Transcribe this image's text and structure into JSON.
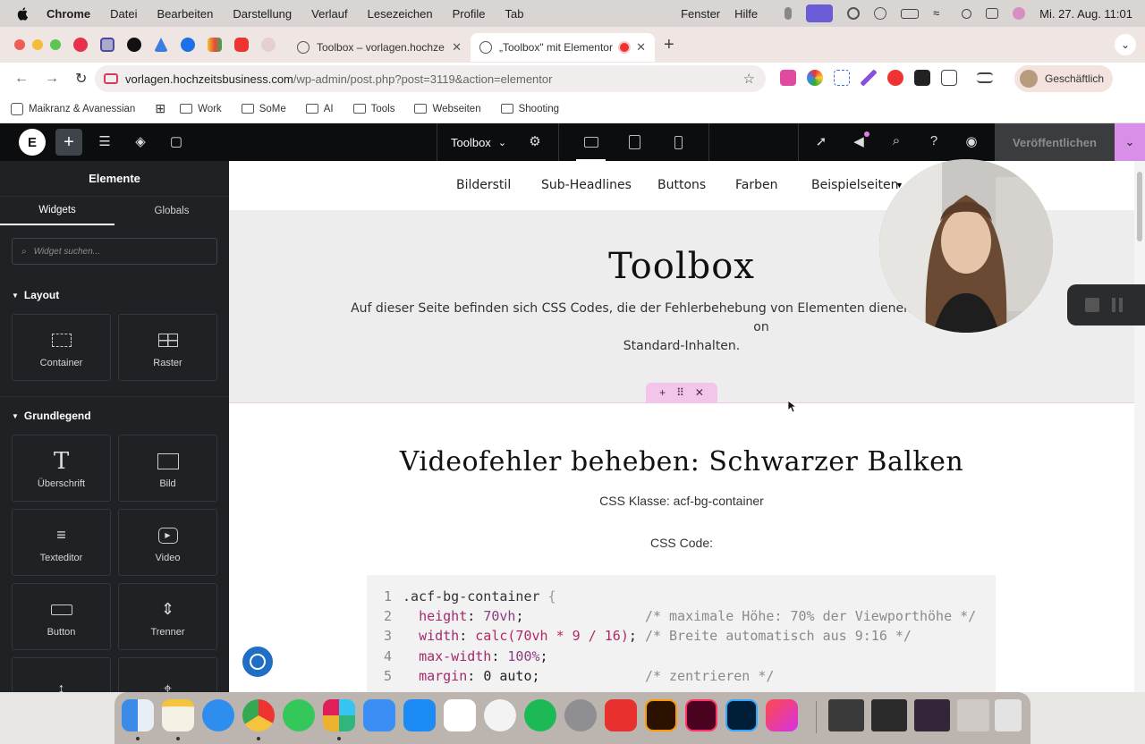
{
  "menubar": {
    "app": "Chrome",
    "items": [
      "Datei",
      "Bearbeiten",
      "Darstellung",
      "Verlauf",
      "Lesezeichen",
      "Profile",
      "Tab",
      "Fenster",
      "Hilfe"
    ],
    "clock": "Mi. 27. Aug.  11:01"
  },
  "tabs": [
    {
      "title": "Toolbox – vorlagen.hochzeits"
    },
    {
      "title": "„Toolbox\" mit Elementor b"
    }
  ],
  "address": {
    "host": "vorlagen.hochzeitsbusiness.com",
    "path": "/wp-admin/post.php?post=3119&action=elementor"
  },
  "profile": {
    "label": "Geschäftlich"
  },
  "bookmarks": [
    "Maikranz & Avanessian",
    "Work",
    "SoMe",
    "AI",
    "Tools",
    "Webseiten",
    "Shooting"
  ],
  "elementor": {
    "document": "Toolbox",
    "publish": "Veröffentlichen",
    "panel": {
      "title": "Elemente",
      "tabs": [
        "Widgets",
        "Globals"
      ],
      "search_placeholder": "Widget suchen...",
      "sections": [
        {
          "label": "Layout",
          "widgets": [
            "Container",
            "Raster"
          ]
        },
        {
          "label": "Grundlegend",
          "widgets": [
            "Überschrift",
            "Bild",
            "Texteditor",
            "Video",
            "Button",
            "Trenner"
          ]
        }
      ]
    }
  },
  "site": {
    "nav": [
      "Bilderstil",
      "Sub-Headlines",
      "Buttons",
      "Farben",
      "Beispielseiten"
    ],
    "hero_title": "Toolbox",
    "hero_text": "Auf dieser Seite befinden sich CSS Codes, die der Fehlerbehebung von Elementen dienen. Primär aber au",
    "hero_text_tail": "on",
    "hero_text_line2": "Standard-Inhalten.",
    "section_title": "Videofehler beheben: Schwarzer Balken",
    "css_class": "CSS Klasse: acf-bg-container",
    "css_code_label": "CSS Code:",
    "code_lines": [
      {
        "n": "1",
        "sel": ".acf-bg-container",
        "rest": " {"
      },
      {
        "n": "2",
        "prop": "height",
        "val": "70vh",
        "pad": "               ",
        "comment": "/* maximale Höhe: 70% der Viewporthöhe */"
      },
      {
        "n": "3",
        "prop": "width",
        "val": "calc(70vh * 9 / 16)",
        "pad": " ",
        "comment": "/* Breite automatisch aus 9:16 */"
      },
      {
        "n": "4",
        "prop": "max-width",
        "val": "100%",
        "pad": "",
        "comment": ""
      },
      {
        "n": "5",
        "prop": "margin",
        "val": "0 auto",
        "pad": "             ",
        "comment": "/* zentrieren */"
      }
    ]
  }
}
